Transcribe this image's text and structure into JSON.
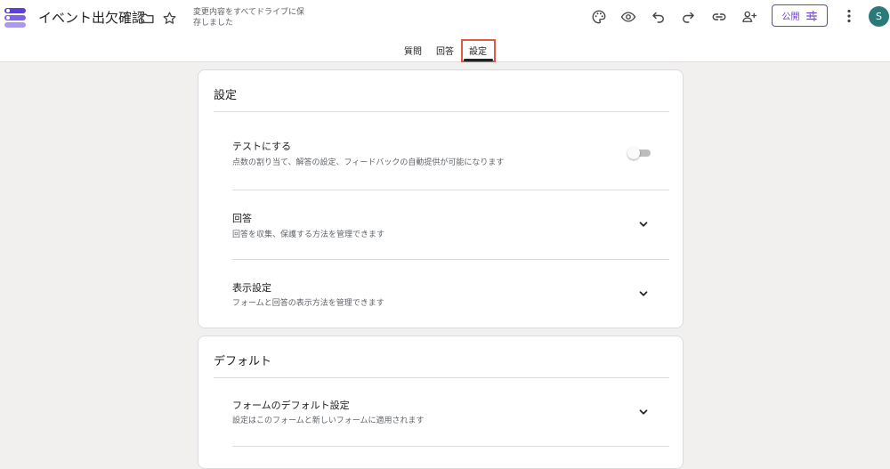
{
  "header": {
    "form_title": "イベント出欠確認",
    "save_status": "変更内容をすべてドライブに保存しました",
    "publish_label": "公開",
    "avatar_initial": "S"
  },
  "tabs": [
    "質問",
    "回答",
    "設定"
  ],
  "settings_card": {
    "title": "設定",
    "rows": [
      {
        "title": "テストにする",
        "desc": "点数の割り当て、解答の設定、フィードバックの自動提供が可能になります",
        "toggle_on": false
      },
      {
        "title": "回答",
        "desc": "回答を収集、保護する方法を管理できます"
      },
      {
        "title": "表示設定",
        "desc": "フォームと回答の表示方法を管理できます"
      }
    ]
  },
  "defaults_card": {
    "title": "デフォルト",
    "rows": [
      {
        "title": "フォームのデフォルト設定",
        "desc": "設定はこのフォームと新しいフォームに適用されます"
      }
    ]
  },
  "colors": {
    "accent": "#6d3fd1",
    "highlight_box": "#e05a3f",
    "avatar_bg": "#2b7a7a",
    "page_bg": "#f1f0ef"
  },
  "icons": [
    "forms-logo-icon",
    "folder-icon",
    "star-icon",
    "palette-icon",
    "preview-eye-icon",
    "undo-icon",
    "redo-icon",
    "link-icon",
    "add-collaborator-icon",
    "tune-icon",
    "more-vert-icon",
    "chevron-down-icon"
  ]
}
